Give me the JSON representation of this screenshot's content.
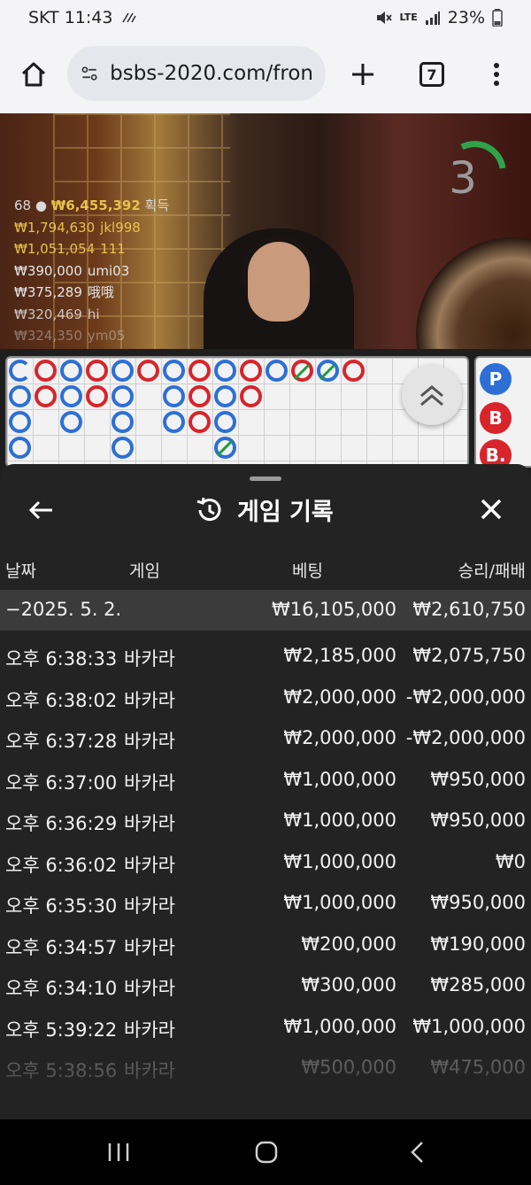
{
  "status": {
    "carrier_time": "SKT 11:43",
    "network": "LTE",
    "battery": "23%"
  },
  "browser": {
    "url": "bsbs-2020.com/fron",
    "tab_count": "7"
  },
  "video": {
    "timer": "3",
    "leaderboard": {
      "header_count": "68",
      "header_amount": "₩6,455,392",
      "header_suffix": "획득",
      "rows": [
        {
          "amount": "₩1,794,630",
          "name": "jkl998"
        },
        {
          "amount": "₩1,051,054",
          "name": "111"
        },
        {
          "amount": "₩390,000",
          "name": "umi03"
        },
        {
          "amount": "₩375,289",
          "name": "哦哦"
        },
        {
          "amount": "₩320,469",
          "name": "hi"
        },
        {
          "amount": "₩324,350",
          "name": "ym05"
        }
      ]
    }
  },
  "side_panel": {
    "p_label": "P",
    "b_label": "B",
    "b2_label": "B."
  },
  "history": {
    "title": "게임 기록",
    "columns": {
      "date": "날짜",
      "game": "게임",
      "bet": "베팅",
      "result": "승리/패배"
    },
    "date_row": {
      "date": "−2025. 5. 2.",
      "bet": "₩16,105,000",
      "result": "₩2,610,750"
    },
    "rows": [
      {
        "time": "오후 6:38:33",
        "game": "바카라",
        "bet": "₩2,185,000",
        "result": "₩2,075,750"
      },
      {
        "time": "오후 6:38:02",
        "game": "바카라",
        "bet": "₩2,000,000",
        "result": "-₩2,000,000"
      },
      {
        "time": "오후 6:37:28",
        "game": "바카라",
        "bet": "₩2,000,000",
        "result": "-₩2,000,000"
      },
      {
        "time": "오후 6:37:00",
        "game": "바카라",
        "bet": "₩1,000,000",
        "result": "₩950,000"
      },
      {
        "time": "오후 6:36:29",
        "game": "바카라",
        "bet": "₩1,000,000",
        "result": "₩950,000"
      },
      {
        "time": "오후 6:36:02",
        "game": "바카라",
        "bet": "₩1,000,000",
        "result": "₩0"
      },
      {
        "time": "오후 6:35:30",
        "game": "바카라",
        "bet": "₩1,000,000",
        "result": "₩950,000"
      },
      {
        "time": "오후 6:34:57",
        "game": "바카라",
        "bet": "₩200,000",
        "result": "₩190,000"
      },
      {
        "time": "오후 6:34:10",
        "game": "바카라",
        "bet": "₩300,000",
        "result": "₩285,000"
      },
      {
        "time": "오후 5:39:22",
        "game": "바카라",
        "bet": "₩1,000,000",
        "result": "₩1,000,000"
      },
      {
        "time": "오후 5:38:56",
        "game": "바카라",
        "bet": "₩500,000",
        "result": "₩475,000"
      }
    ]
  }
}
